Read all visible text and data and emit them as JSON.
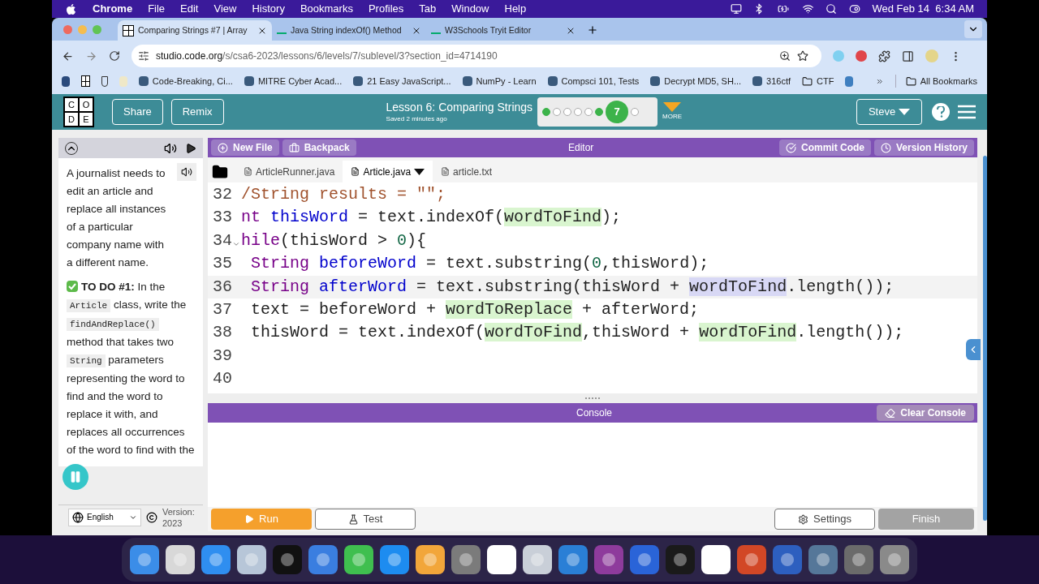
{
  "menu_bar": {
    "app": "Chrome",
    "items": [
      "File",
      "Edit",
      "View",
      "History",
      "Bookmarks",
      "Profiles",
      "Tab",
      "Window",
      "Help"
    ],
    "clock": "Wed Feb 14  6:34 AM"
  },
  "browser": {
    "tabs": [
      {
        "title": "Comparing Strings #7 | Array",
        "selected": true,
        "kind": "code"
      },
      {
        "title": "Java String indexOf() Method",
        "selected": false,
        "kind": "w3"
      },
      {
        "title": "W3Schools Tryit Editor",
        "selected": false,
        "kind": "w3"
      }
    ],
    "url": {
      "host": "studio.code.org",
      "path": "/s/csa6-2023/lessons/6/levels/7/sublevel/3?section_id=4714190"
    },
    "bookmarks": [
      {
        "label": "Code-Breaking, Ci...",
        "kind": "site"
      },
      {
        "label": "MITRE Cyber Acad...",
        "kind": "site"
      },
      {
        "label": "21 Easy JavaScript...",
        "kind": "site"
      },
      {
        "label": "NumPy - Learn",
        "kind": "site"
      },
      {
        "label": "Compsci 101, Tests",
        "kind": "site"
      },
      {
        "label": "Decrypt MD5, SH...",
        "kind": "site"
      },
      {
        "label": "316ctf",
        "kind": "site"
      },
      {
        "label": "CTF",
        "kind": "folder"
      }
    ],
    "all_bookmarks": "All Bookmarks"
  },
  "header": {
    "logo": [
      "C",
      "O",
      "D",
      "E"
    ],
    "buttons": [
      "Share",
      "Remix"
    ],
    "lesson_title": "Lesson 6: Comparing Strings",
    "saved": "Saved 2 minutes ago",
    "progress": [
      {
        "kind": "dot",
        "done": true
      },
      {
        "kind": "dot",
        "done": false
      },
      {
        "kind": "dot",
        "done": false
      },
      {
        "kind": "dot",
        "done": false
      },
      {
        "kind": "dot",
        "done": false
      },
      {
        "kind": "dot",
        "done": true
      },
      {
        "kind": "current",
        "label": "7"
      },
      {
        "kind": "dot",
        "done": false
      }
    ],
    "more": "MORE",
    "user": "Steve"
  },
  "instructions": {
    "paragraphs": [
      [
        {
          "kind": "text",
          "text": "A journalist needs to edit an article and replace all instances of a particular company name with a different name."
        }
      ],
      [
        {
          "kind": "check"
        },
        {
          "kind": "bold",
          "text": "TO DO #1:"
        },
        {
          "kind": "text",
          "text": " In the "
        },
        {
          "kind": "code",
          "text": "Article"
        },
        {
          "kind": "text",
          "text": " class, write the "
        },
        {
          "kind": "code",
          "text": "findAndReplace()"
        },
        {
          "kind": "text",
          "text": " method that takes two "
        },
        {
          "kind": "code",
          "text": "String"
        },
        {
          "kind": "text",
          "text": " parameters representing the word to find and the word to replace it with, and replaces all occurrences of the word to find with the"
        }
      ]
    ],
    "language": "English",
    "version": "Version: 2023"
  },
  "editor": {
    "title": "Editor",
    "left_buttons": [
      {
        "label": "New File",
        "kind": "add"
      },
      {
        "label": "Backpack",
        "kind": "backpack"
      }
    ],
    "right_buttons": [
      {
        "label": "Commit Code",
        "kind": "commit"
      },
      {
        "label": "Version History",
        "kind": "history"
      }
    ],
    "files": [
      {
        "name": "ArticleRunner.java",
        "selected": false
      },
      {
        "name": "Article.java",
        "selected": true
      },
      {
        "name": "article.txt",
        "selected": false
      }
    ],
    "lines": [
      {
        "number": "32",
        "active": false,
        "fold": false,
        "tokens": [
          {
            "kind": "comment",
            "text": "/String results = \"\";"
          }
        ]
      },
      {
        "number": "33",
        "active": false,
        "fold": false,
        "tokens": [
          {
            "kind": "keyword",
            "text": "nt"
          },
          {
            "kind": "def",
            "text": " thisWord"
          },
          {
            "kind": "plain",
            "text": " = text.indexOf("
          },
          {
            "kind": "match",
            "text": "wordToFind"
          },
          {
            "kind": "plain",
            "text": ");"
          }
        ]
      },
      {
        "number": "34",
        "active": false,
        "fold": true,
        "tokens": [
          {
            "kind": "keyword",
            "text": "hile"
          },
          {
            "kind": "plain",
            "text": "(thisWord > "
          },
          {
            "kind": "number",
            "text": "0"
          },
          {
            "kind": "plain",
            "text": "){"
          }
        ]
      },
      {
        "number": "35",
        "active": false,
        "fold": false,
        "tokens": [
          {
            "kind": "keyword",
            "text": " String"
          },
          {
            "kind": "def",
            "text": " beforeWord"
          },
          {
            "kind": "plain",
            "text": " = text.substring("
          },
          {
            "kind": "number",
            "text": "0"
          },
          {
            "kind": "plain",
            "text": ",thisWord);"
          }
        ]
      },
      {
        "number": "36",
        "active": true,
        "fold": false,
        "tokens": [
          {
            "kind": "keyword",
            "text": " String"
          },
          {
            "kind": "def",
            "text": " afterWord"
          },
          {
            "kind": "plain",
            "text": " = text.substring(thisWord + "
          },
          {
            "kind": "selected_match",
            "text": "wordToFind"
          },
          {
            "kind": "plain",
            "text": ".length());"
          }
        ]
      },
      {
        "number": "37",
        "active": false,
        "fold": false,
        "tokens": [
          {
            "kind": "plain",
            "text": " text = beforeWord + "
          },
          {
            "kind": "match",
            "text": "wordToReplace"
          },
          {
            "kind": "plain",
            "text": " + afterWord;"
          }
        ]
      },
      {
        "number": "38",
        "active": false,
        "fold": false,
        "tokens": [
          {
            "kind": "plain",
            "text": " thisWord = text.indexOf("
          },
          {
            "kind": "match",
            "text": "wordToFind"
          },
          {
            "kind": "plain",
            "text": ",thisWord + "
          },
          {
            "kind": "match",
            "text": "wordToFind"
          },
          {
            "kind": "plain",
            "text": ".length());"
          }
        ]
      },
      {
        "number": "39",
        "active": false,
        "fold": false
      },
      {
        "number": "40",
        "active": false,
        "fold": false
      }
    ]
  },
  "console": {
    "title": "Console",
    "clear": "Clear Console"
  },
  "bottom": {
    "run": "Run",
    "test": "Test",
    "settings": "Settings",
    "finish": "Finish"
  }
}
